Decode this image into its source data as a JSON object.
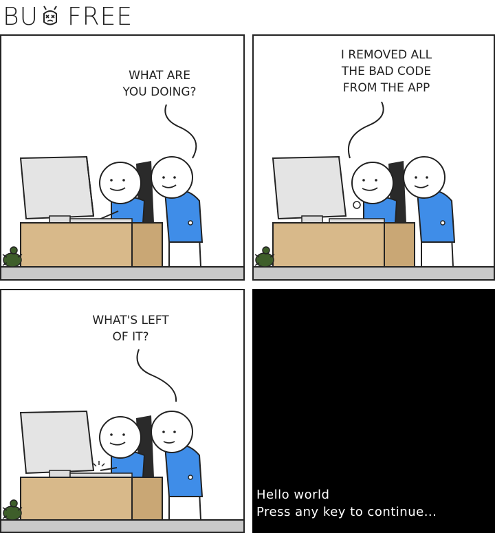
{
  "comic": {
    "title_part1": "BU",
    "title_part2": "FREE",
    "panels": [
      {
        "speech": "WHAT ARE\nYOU DOING?"
      },
      {
        "speech": "I REMOVED ALL\nTHE BAD CODE\nFROM THE APP"
      },
      {
        "speech": "WHAT'S LEFT\nOF IT?"
      }
    ],
    "terminal": {
      "line1": "Hello world",
      "line2": "Press any key to continue..."
    }
  },
  "colors": {
    "desk": "#d8b98a",
    "desk_dark": "#c9a775",
    "shirt": "#3f8de8",
    "floor": "#c9c9c9",
    "bug": "#3e5e2a",
    "chair": "#2a2a2a",
    "monitor": "#e4e4e4"
  }
}
